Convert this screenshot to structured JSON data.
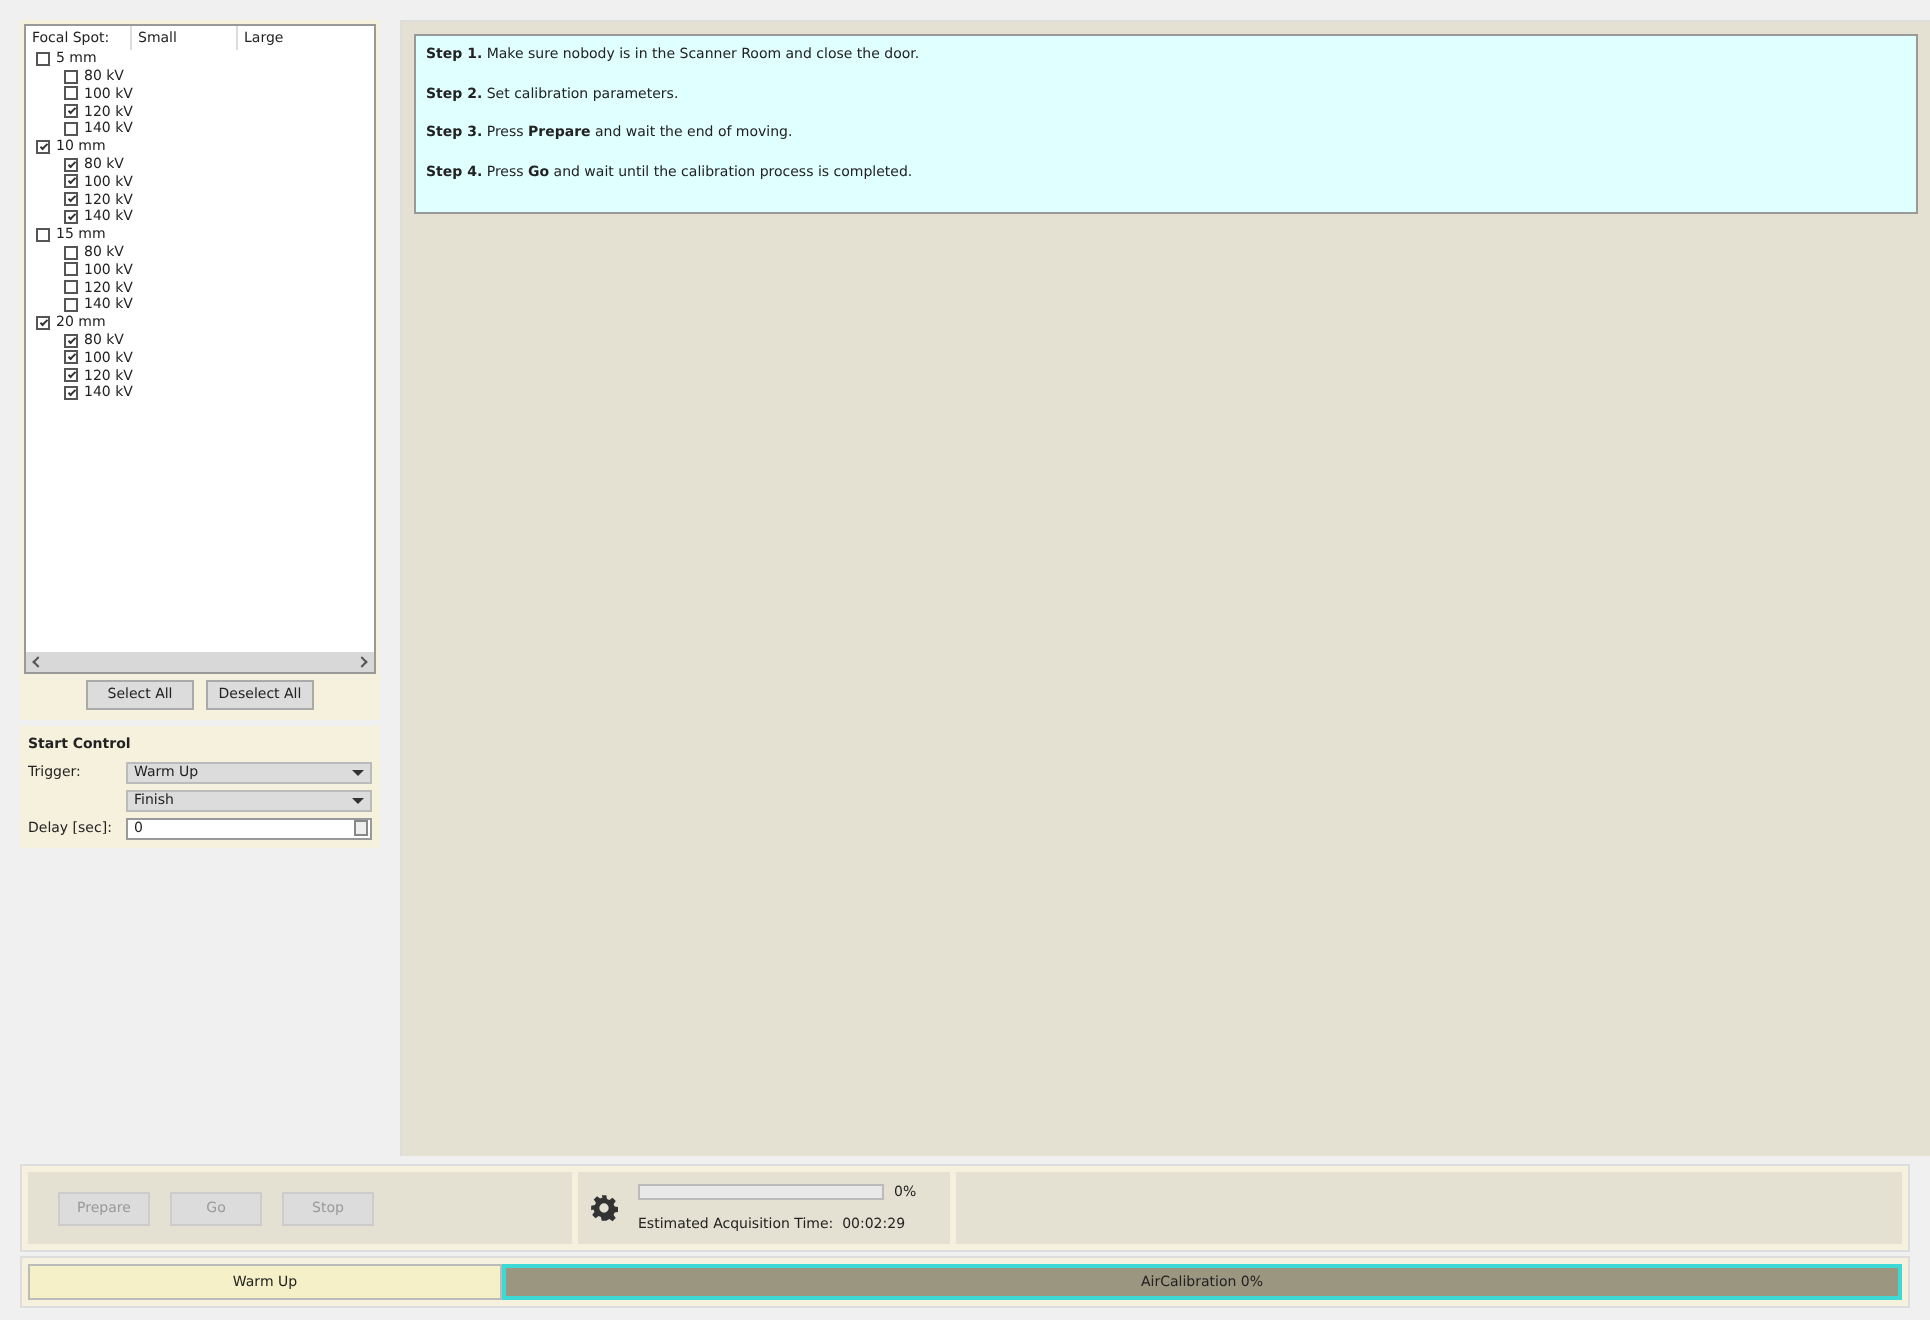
{
  "focal_spot_tree": {
    "columns": [
      "Focal Spot:",
      "Small",
      "Large"
    ],
    "items": [
      {
        "label": "5 mm",
        "checked": false,
        "children": [
          {
            "label": "80 kV",
            "checked": false
          },
          {
            "label": "100 kV",
            "checked": false
          },
          {
            "label": "120 kV",
            "checked": true
          },
          {
            "label": "140 kV",
            "checked": false
          }
        ]
      },
      {
        "label": "10 mm",
        "checked": true,
        "children": [
          {
            "label": "80 kV",
            "checked": true
          },
          {
            "label": "100 kV",
            "checked": true
          },
          {
            "label": "120 kV",
            "checked": true
          },
          {
            "label": "140 kV",
            "checked": true
          }
        ]
      },
      {
        "label": "15 mm",
        "checked": false,
        "children": [
          {
            "label": "80 kV",
            "checked": false
          },
          {
            "label": "100 kV",
            "checked": false
          },
          {
            "label": "120 kV",
            "checked": false
          },
          {
            "label": "140 kV",
            "checked": false
          }
        ]
      },
      {
        "label": "20 mm",
        "checked": true,
        "children": [
          {
            "label": "80 kV",
            "checked": true
          },
          {
            "label": "100 kV",
            "checked": true
          },
          {
            "label": "120 kV",
            "checked": true
          },
          {
            "label": "140 kV",
            "checked": true
          }
        ]
      }
    ],
    "buttons": [
      "Select All",
      "Deselect All"
    ]
  },
  "start_control": {
    "title": "Start Control",
    "trigger_label": "Trigger:",
    "trigger": "Warm Up",
    "trigger_2": "Finish",
    "delay_label": "Delay [sec]:",
    "delay": "0"
  },
  "instructions": [
    "**Step 1.** Make sure nobody is in the Scanner Room and close the door.",
    "**Step 2.** Set calibration parameters.",
    "**Step 3.** Press **Prepare** and wait the end of moving.",
    "**Step 4.** Press **Go** and wait until the calibration process is completed."
  ],
  "controls": [
    {
      "label": "Prepare",
      "disabled": true
    },
    {
      "label": "Go",
      "disabled": true
    },
    {
      "label": "Stop",
      "disabled": true
    }
  ],
  "progress": {
    "level": 0,
    "reading": "0%",
    "estimate": "Estimated Acquisition Time:  00:02:29"
  },
  "workflow": [
    {
      "label": "Warm Up",
      "selected": false
    },
    {
      "label": "AirCalibration 0%",
      "selected": true
    }
  ]
}
